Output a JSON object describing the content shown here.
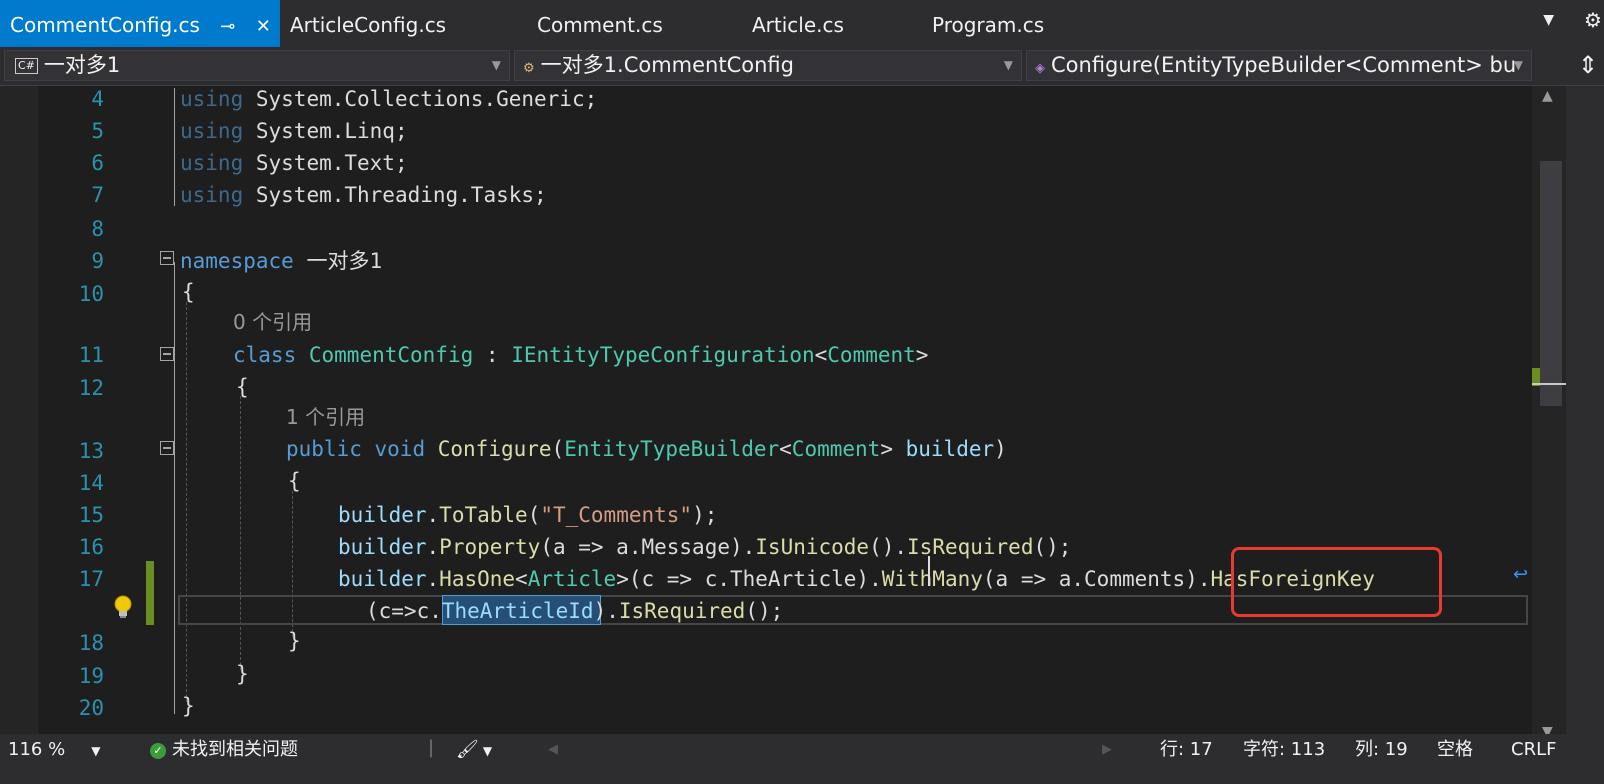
{
  "tabs": [
    {
      "label": "CommentConfig.cs",
      "active": true,
      "pin_icon": "pin-icon",
      "close_icon": "close-icon"
    },
    {
      "label": "ArticleConfig.cs",
      "active": false
    },
    {
      "label": "Comment.cs",
      "active": false
    },
    {
      "label": "Article.cs",
      "active": false
    },
    {
      "label": "Program.cs",
      "active": false
    }
  ],
  "navbar": {
    "project_badge": "C#",
    "project": "一对多1",
    "type": "一对多1.CommentConfig",
    "member": "Configure(EntityTypeBuilder<Comment> bu"
  },
  "code": {
    "line_numbers": [
      "4",
      "5",
      "6",
      "7",
      "8",
      "9",
      "10",
      "11",
      "12",
      "13",
      "14",
      "15",
      "16",
      "17",
      "18",
      "19",
      "20"
    ],
    "lens": [
      "0 个引用",
      "1 个引用"
    ],
    "using_kw": "using",
    "usings": [
      "System.Collections.Generic;",
      "System.Linq;",
      "System.Text;",
      "System.Threading.Tasks;"
    ],
    "namespace_kw": "namespace",
    "namespace_name": "一对多1",
    "brace_open": "{",
    "brace_close": "}",
    "class_kw": "class",
    "class_name": "CommentConfig",
    "colon": " : ",
    "interface": "IEntityTypeConfiguration",
    "lt": "<",
    "gt": ">",
    "generic_arg": "Comment",
    "public_kw": "public",
    "void_kw": "void",
    "method": "Configure",
    "builder_type": "EntityTypeBuilder",
    "builder_param": "builder",
    "builder": "builder",
    "dot": ".",
    "totable": "ToTable",
    "table_name": "\"T_Comments\"",
    "property": "Property",
    "lambda_a_msg": "(a => a.Message)",
    "isunicode": "IsUnicode",
    "isrequired": "IsRequired",
    "hasone": "HasOne",
    "article_type": "Article",
    "lambda_c_article": "(c => c.TheArticle)",
    "withmany": "WithMany",
    "lambda_a_comments": "(a => a.Comments)",
    "hasforeignkey": "HasForeignKey",
    "cont_prefix": "(c=>c.",
    "fk_prop": "TheArticleId",
    "cont_suffix": ").",
    "call_end": "();"
  },
  "status": {
    "zoom": "116 %",
    "issues": "未找到相关问题",
    "line": "行: 17",
    "char": "字符: 113",
    "col": "列: 19",
    "whitespace": "空格",
    "eol": "CRLF"
  },
  "colors": {
    "accent": "#007acc",
    "highlight_box": "#e63b2e",
    "keyword": "#569cd6",
    "type": "#4ec9b0",
    "method": "#dcdcaa",
    "string": "#d69d85",
    "param": "#9cdcfe"
  }
}
